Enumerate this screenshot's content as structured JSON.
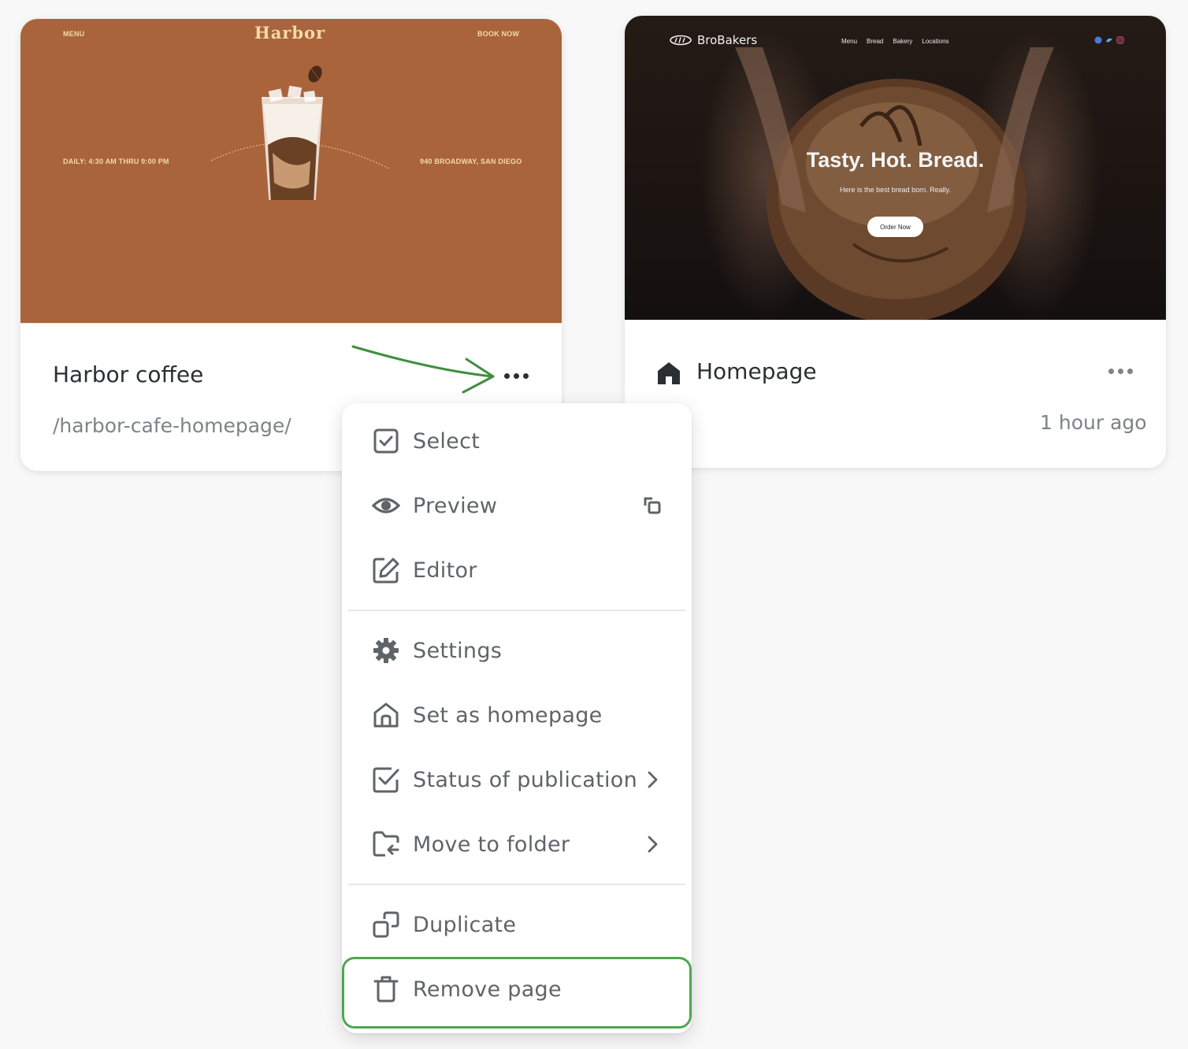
{
  "cards": {
    "harbor": {
      "title": "Harbor coffee",
      "slug": "/harbor-cafe-homepage/",
      "preview": {
        "logo": "Harbor",
        "menu": "MENU",
        "book": "BOOK NOW",
        "hours": "DAILY: 4:30 AM THRU 9:00 PM",
        "address": "940 BROADWAY, SAN DIEGO",
        "bg_color": "#a9643c"
      }
    },
    "bro": {
      "title": "Homepage",
      "time": "1 hour ago",
      "preview": {
        "logo": "BroBakers",
        "nav": [
          "Menu",
          "Bread",
          "Bakery",
          "Locations"
        ],
        "headline": "Tasty. Hot. Bread.",
        "subline": "Here is the best bread born. Really.",
        "cta": "Order Now"
      }
    }
  },
  "context_menu": {
    "select": "Select",
    "preview": "Preview",
    "editor": "Editor",
    "settings": "Settings",
    "set_homepage": "Set as homepage",
    "status": "Status of publication",
    "move": "Move to folder",
    "duplicate": "Duplicate",
    "remove": "Remove page"
  },
  "icons": {
    "select": "checkbox-icon",
    "preview": "eye-icon",
    "editor": "edit-icon",
    "settings": "gear-icon",
    "set_homepage": "home-icon",
    "status": "checkbox-icon",
    "move": "folder-move-icon",
    "duplicate": "duplicate-icon",
    "remove": "trash-icon"
  },
  "colors": {
    "highlight": "#4ea84e",
    "annotation_arrow": "#3f8f3f",
    "menu_text": "#5f6469"
  }
}
